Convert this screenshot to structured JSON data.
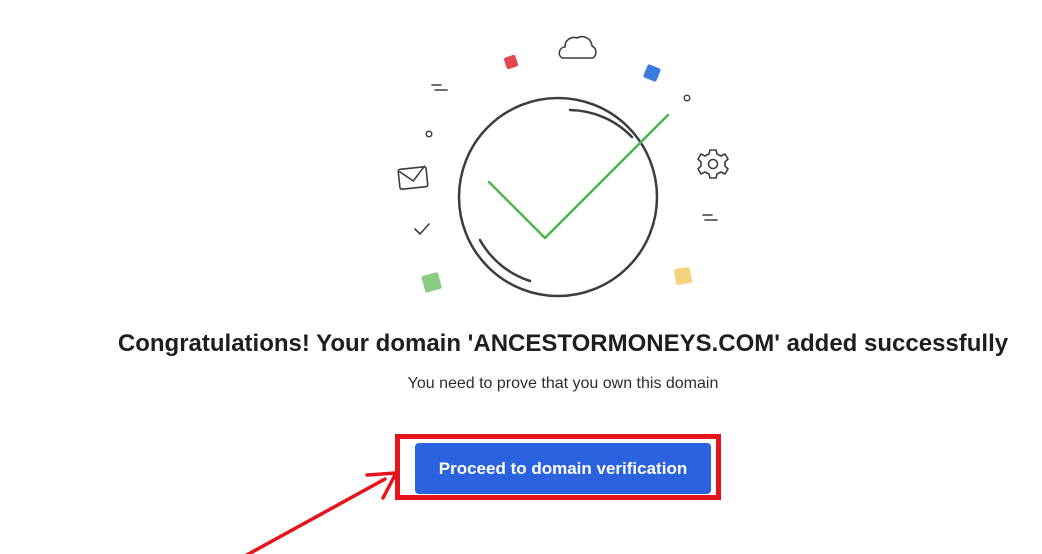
{
  "dialog": {
    "headline": "Congratulations! Your domain 'ANCESTORMONEYS.COM' added successfully",
    "subtext": "You need to prove that you own this domain",
    "proceed_button_label": "Proceed to domain verification"
  },
  "icons": {
    "success": "success-check-icon",
    "cloud": "cloud-icon",
    "envelope": "envelope-icon",
    "gear": "gear-icon",
    "small_check": "small-check-icon"
  },
  "colors": {
    "primary_button": "#2a62e0",
    "success_check": "#4cb54c",
    "annotation_red": "#e5131b",
    "confetti_red": "#e5474e",
    "confetti_blue": "#3b7be0",
    "confetti_green": "#8acb82",
    "confetti_yellow": "#f4d37c"
  }
}
